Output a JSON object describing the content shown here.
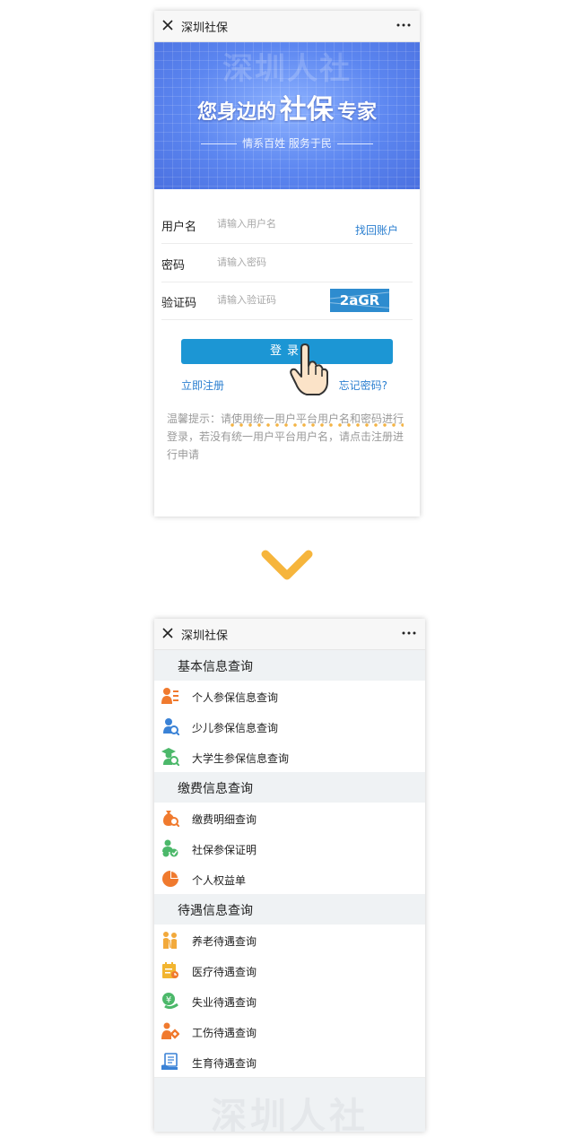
{
  "login_page": {
    "title": "深圳社保",
    "banner": {
      "watermark": "深圳人社",
      "slogan_a": "您身边的",
      "slogan_b": "社保",
      "slogan_c": "专家",
      "subtitle": "情系百姓  服务于民"
    },
    "username": {
      "label": "用户名",
      "placeholder": "请输入用户名",
      "link": "找回账户"
    },
    "password": {
      "label": "密码",
      "placeholder": "请输入密码"
    },
    "captcha": {
      "label": "验证码",
      "placeholder": "请输入验证码",
      "code": "2aGR"
    },
    "login_button": "登录",
    "register_link": "立即注册",
    "forgot_link": "忘记密码?",
    "tip": "温馨提示：请使用统一用户平台用户名和密码进行登录，若没有统一用户平台用户名，请点击注册进行申请"
  },
  "menu_page": {
    "title": "深圳社保",
    "sections": [
      {
        "title": "基本信息查询",
        "items": [
          {
            "label": "个人参保信息查询",
            "icon": "person-list-icon"
          },
          {
            "label": "少儿参保信息查询",
            "icon": "child-search-icon"
          },
          {
            "label": "大学生参保信息查询",
            "icon": "graduate-search-icon"
          }
        ]
      },
      {
        "title": "缴费信息查询",
        "items": [
          {
            "label": "缴费明细查询",
            "icon": "money-bag-search-icon"
          },
          {
            "label": "社保参保证明",
            "icon": "certificate-people-icon"
          },
          {
            "label": "个人权益单",
            "icon": "pie-chart-icon"
          }
        ]
      },
      {
        "title": "待遇信息查询",
        "items": [
          {
            "label": "养老待遇查询",
            "icon": "elderly-icon"
          },
          {
            "label": "医疗待遇查询",
            "icon": "medical-calendar-icon"
          },
          {
            "label": "失业待遇查询",
            "icon": "unemployment-icon"
          },
          {
            "label": "工伤待遇查询",
            "icon": "injury-icon"
          },
          {
            "label": "生育待遇查询",
            "icon": "maternity-icon"
          }
        ]
      }
    ],
    "watermark": "深圳人社"
  },
  "colors": {
    "primary": "#1c96d4",
    "link": "#2b7fd0",
    "icon_orange": "#f07a2e",
    "icon_green": "#4cb86a",
    "icon_blue": "#3a82d6",
    "arrow": "#f6b53c"
  }
}
